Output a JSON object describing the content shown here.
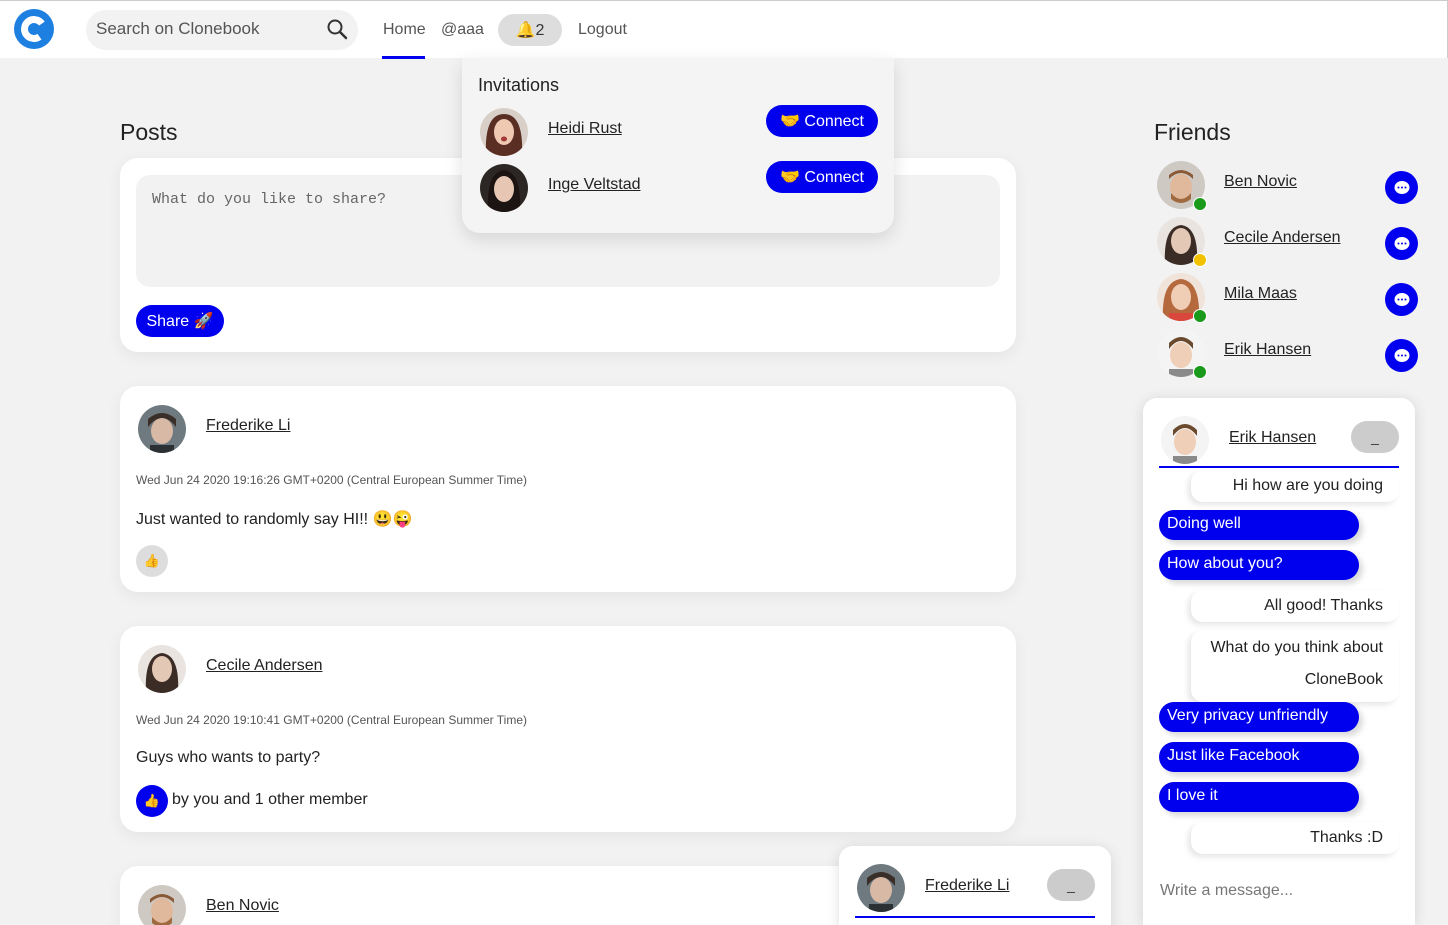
{
  "header": {
    "search_placeholder": "Search on Clonebook",
    "nav": {
      "home": "Home",
      "user": "@aaa",
      "notifications": "🔔2",
      "logout": "Logout"
    }
  },
  "invitations": {
    "title": "Invitations",
    "items": [
      {
        "name": "Heidi Rust",
        "action": "🤝 Connect"
      },
      {
        "name": "Inge Veltstad",
        "action": "🤝 Connect"
      }
    ]
  },
  "posts": {
    "heading": "Posts",
    "composer_placeholder": "What do you like to share?",
    "share_label": "Share 🚀",
    "items": [
      {
        "author": "Frederike Li",
        "date": "Wed Jun 24 2020 19:16:26 GMT+0200 (Central European Summer Time)",
        "text": "Just wanted to randomly say HI!! 😃😜",
        "like_icon": "👍",
        "likes_text": ""
      },
      {
        "author": "Cecile Andersen",
        "date": "Wed Jun 24 2020 19:10:41 GMT+0200 (Central European Summer Time)",
        "text": "Guys who wants to party?",
        "like_icon": "👍",
        "likes_text": "by you and 1 other member"
      },
      {
        "author": "Ben Novic"
      }
    ]
  },
  "friends": {
    "heading": "Friends",
    "items": [
      {
        "name": "Ben Novic",
        "status": "online",
        "status_color": "#1a9a1a"
      },
      {
        "name": "Cecile Andersen",
        "status": "away",
        "status_color": "#f2c200"
      },
      {
        "name": "Mila Maas",
        "status": "online",
        "status_color": "#1a9a1a"
      },
      {
        "name": "Erik Hansen",
        "status": "online",
        "status_color": "#1a9a1a"
      }
    ]
  },
  "chat_erik": {
    "name": "Erik Hansen",
    "minimize_label": "_",
    "messages": [
      {
        "dir": "in",
        "text": "Hi how are you doing"
      },
      {
        "dir": "out",
        "text": "Doing well"
      },
      {
        "dir": "out",
        "text": "How about you?"
      },
      {
        "dir": "in",
        "text": "All good! Thanks"
      },
      {
        "dir": "in",
        "text": "What do you think about CloneBook"
      },
      {
        "dir": "out",
        "text": "Very privacy unfriendly"
      },
      {
        "dir": "out",
        "text": "Just like Facebook"
      },
      {
        "dir": "out",
        "text": "I love it"
      },
      {
        "dir": "in",
        "text": "Thanks :D"
      }
    ],
    "input_placeholder": "Write a message..."
  },
  "chat_frederike": {
    "name": "Frederike Li",
    "minimize_label": "_"
  },
  "colors": {
    "accent": "#0000ee",
    "online": "#1a9a1a",
    "away": "#f2c200",
    "page_bg": "#f2f2f2"
  }
}
